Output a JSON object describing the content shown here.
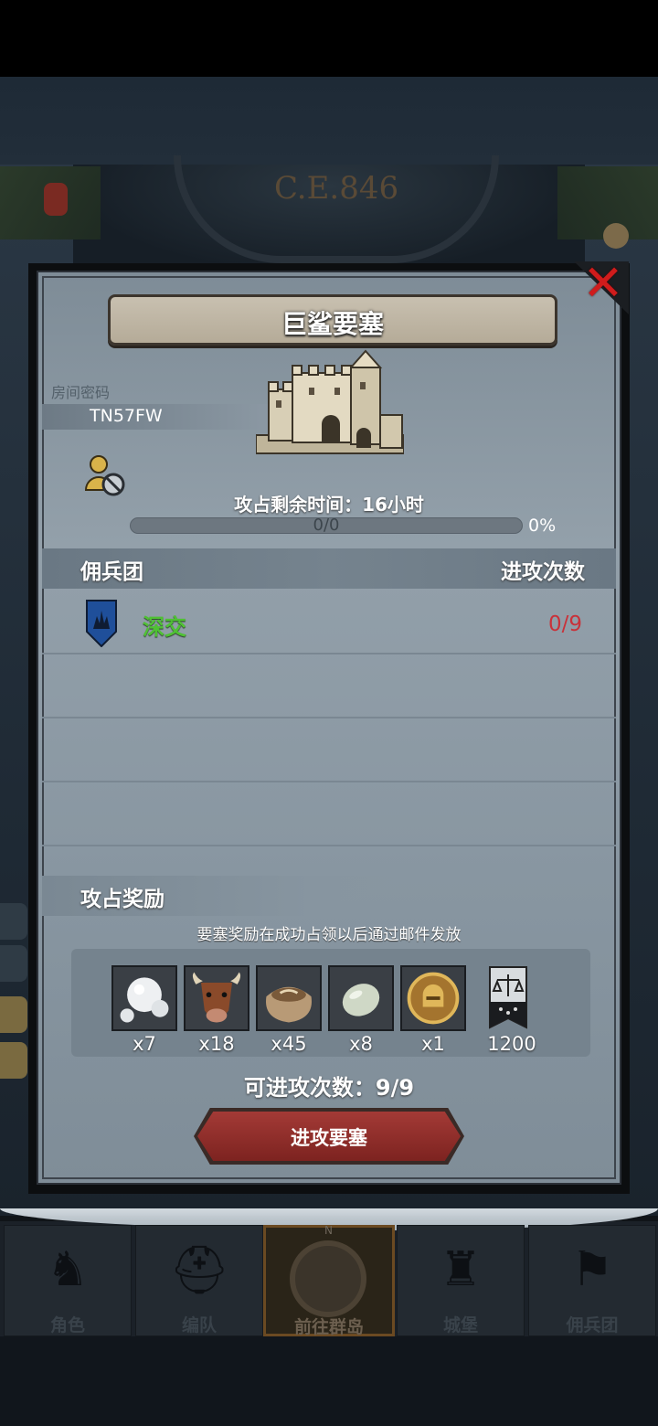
{
  "calendar": {
    "era_text": "C.E.846"
  },
  "dialog": {
    "title": "巨鲨要塞",
    "room_password_label": "房间密码",
    "room_password": "TN57FW",
    "remaining_time_label": "攻占剩余时间：16小时",
    "progress_text": "0/0",
    "progress_percent_text": "0%",
    "progress_fraction": 0.0,
    "table_header_left": "佣兵团",
    "table_header_right": "进攻次数",
    "guild": {
      "name": "深交",
      "attacks": "0/9"
    },
    "rewards_title": "攻占奖励",
    "rewards_note": "要塞奖励在成功占领以后通过邮件发放",
    "rewards": [
      {
        "icon": "pearl-icon",
        "count": "x7"
      },
      {
        "icon": "cow-icon",
        "count": "x18"
      },
      {
        "icon": "grain-sack-icon",
        "count": "x45"
      },
      {
        "icon": "gemstone-icon",
        "count": "x8"
      },
      {
        "icon": "knight-medal-icon",
        "count": "x1"
      },
      {
        "icon": "justice-banner-icon",
        "count": "1200"
      }
    ],
    "available_attacks": "可进攻次数：9/9",
    "attack_button": "进攻要塞"
  },
  "nav": {
    "items": [
      {
        "label": "角色"
      },
      {
        "label": "编队"
      },
      {
        "label": "前往群岛"
      },
      {
        "label": "城堡"
      },
      {
        "label": "佣兵团"
      }
    ]
  },
  "colors": {
    "guild_name": "#4fc134",
    "attacks_value": "#c9323a",
    "close_x": "#d01c1c",
    "attack_button": "#8f2e2a"
  }
}
